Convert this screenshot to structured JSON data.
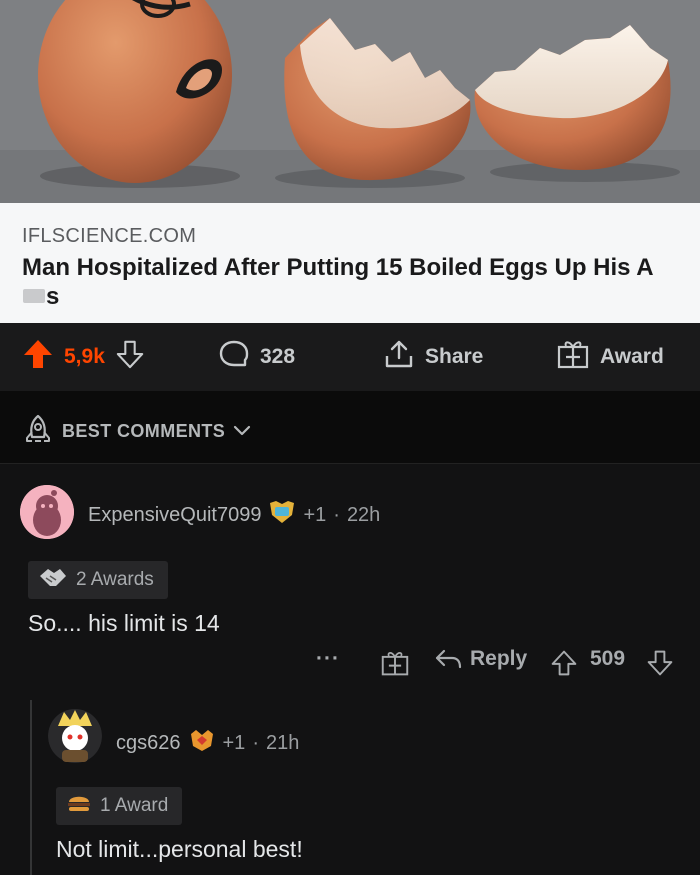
{
  "post": {
    "link_domain": "IFLSCIENCE.COM",
    "title_part1": "Man Hospitalized After Putting 15 Boiled Eggs Up His A",
    "title_part2": "s"
  },
  "actions": {
    "vote_count": "5,9k",
    "comment_count": "328",
    "share_label": "Share",
    "award_label": "Award"
  },
  "sort": {
    "label": "BEST COMMENTS"
  },
  "comments": [
    {
      "author": "ExpensiveQuit7099",
      "karma": "+1",
      "separator": "·",
      "age": "22h",
      "awards_label": "2 Awards",
      "body": "So.... his limit is 14",
      "more_label": "···",
      "reply_label": "Reply",
      "score": "509"
    },
    {
      "author": "cgs626",
      "karma": "+1",
      "separator": "·",
      "age": "21h",
      "awards_label": "1 Award",
      "body": "Not limit...personal best!"
    }
  ],
  "colors": {
    "upvote_active": "#ff4500",
    "card_background": "#f6f7f8",
    "page_background": "#121213",
    "action_bar": "#1a1a1b"
  },
  "icons": [
    "upvote-icon",
    "downvote-icon",
    "comment-icon",
    "share-icon",
    "award-gift-icon",
    "rocket-icon",
    "chevron-down-icon",
    "more-icon",
    "reply-icon"
  ]
}
